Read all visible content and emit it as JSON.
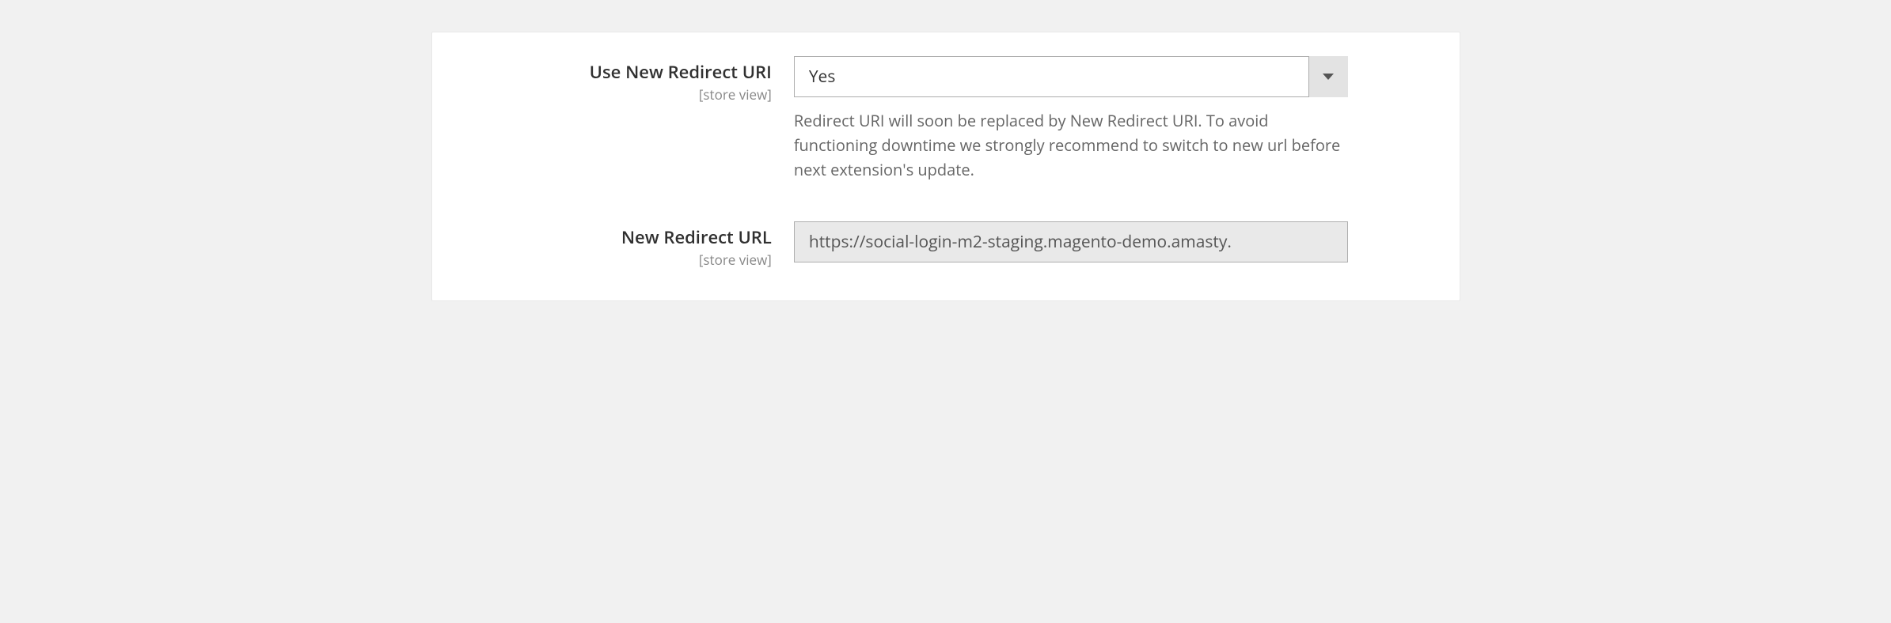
{
  "fields": {
    "useNewRedirect": {
      "label": "Use New Redirect URI",
      "scope": "[store view]",
      "value": "Yes",
      "help": "Redirect URI will soon be replaced by New Redirect URI. To avoid functioning downtime we strongly recommend to switch to new url before next extension's update."
    },
    "newRedirectUrl": {
      "label": "New Redirect URL",
      "scope": "[store view]",
      "value": "https://social-login-m2-staging.magento-demo.amasty."
    }
  }
}
